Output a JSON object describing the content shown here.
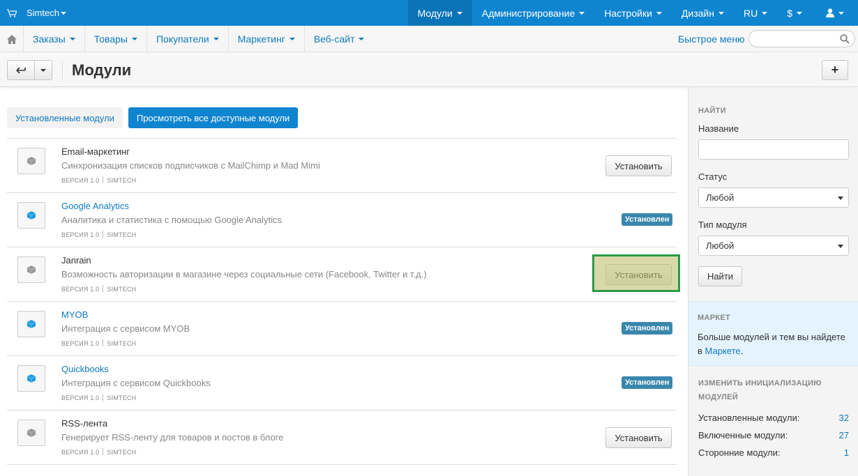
{
  "topbar": {
    "brand": "Simtech",
    "nav": [
      "Модули",
      "Администрирование",
      "Настройки",
      "Дизайн",
      "RU",
      "$"
    ]
  },
  "subbar": {
    "menu": [
      "Заказы",
      "Товары",
      "Покупатели",
      "Маркетинг",
      "Веб-сайт"
    ],
    "quick_menu": "Быстрое меню",
    "search_placeholder": ""
  },
  "titlebar": {
    "title": "Модули",
    "plus": "+"
  },
  "tabs": {
    "installed": "Установленные модули",
    "all": "Просмотреть все доступные модули"
  },
  "modules": [
    {
      "name": "Email-маркетинг",
      "desc": "Синхронизация списков подписчиков с MailChimp и Mad Mimi",
      "version": "ВЕРСИЯ 1.0",
      "vendor": "SIMTECH",
      "action": "Установить",
      "status": ""
    },
    {
      "name": "Google Analytics",
      "desc": "Аналитика и статистика с помощью Google Analytics",
      "version": "ВЕРСИЯ 1.0",
      "vendor": "SIMTECH",
      "action": "",
      "status": "Установлен"
    },
    {
      "name": "Janrain",
      "desc": "Возможность авторизации в магазине через социальные сети (Facebook, Twitter и т.д.)",
      "version": "ВЕРСИЯ 1.0",
      "vendor": "SIMTECH",
      "action": "Установить",
      "status": ""
    },
    {
      "name": "MYOB",
      "desc": "Интеграция с сервисом MYOB",
      "version": "ВЕРСИЯ 1.0",
      "vendor": "SIMTECH",
      "action": "",
      "status": "Установлен"
    },
    {
      "name": "Quickbooks",
      "desc": "Интеграция с сервисом Quickbooks",
      "version": "ВЕРСИЯ 1.0",
      "vendor": "SIMTECH",
      "action": "",
      "status": "Установлен"
    },
    {
      "name": "RSS-лента",
      "desc": "Генерирует RSS-ленту для товаров и постов в блоге",
      "version": "ВЕРСИЯ 1.0",
      "vendor": "SIMTECH",
      "action": "Установить",
      "status": ""
    }
  ],
  "sidebar": {
    "find_heading": "НАЙТИ",
    "name_label": "Название",
    "name_value": "",
    "status_label": "Статус",
    "status_value": "Любой",
    "type_label": "Тип модуля",
    "type_value": "Любой",
    "find_button": "Найти",
    "market_heading": "МАРКЕТ",
    "market_text": "Больше модулей и тем вы найдете в",
    "market_link": "Маркете",
    "market_dot": ".",
    "stats_heading_1": "ИЗМЕНИТЬ ИНИЦИАЛИЗАЦИЮ",
    "stats_heading_2": "МОДУЛЕЙ",
    "stats": [
      {
        "label": "Установленные модули:",
        "value": "32"
      },
      {
        "label": "Включенные модули:",
        "value": "27"
      },
      {
        "label": "Сторонние модули:",
        "value": "1"
      }
    ]
  },
  "colors": {
    "topbar": "#0f85d0",
    "link": "#0f7ac0",
    "badge": "#3a87ad",
    "highlight_border": "#2c9a4c"
  }
}
